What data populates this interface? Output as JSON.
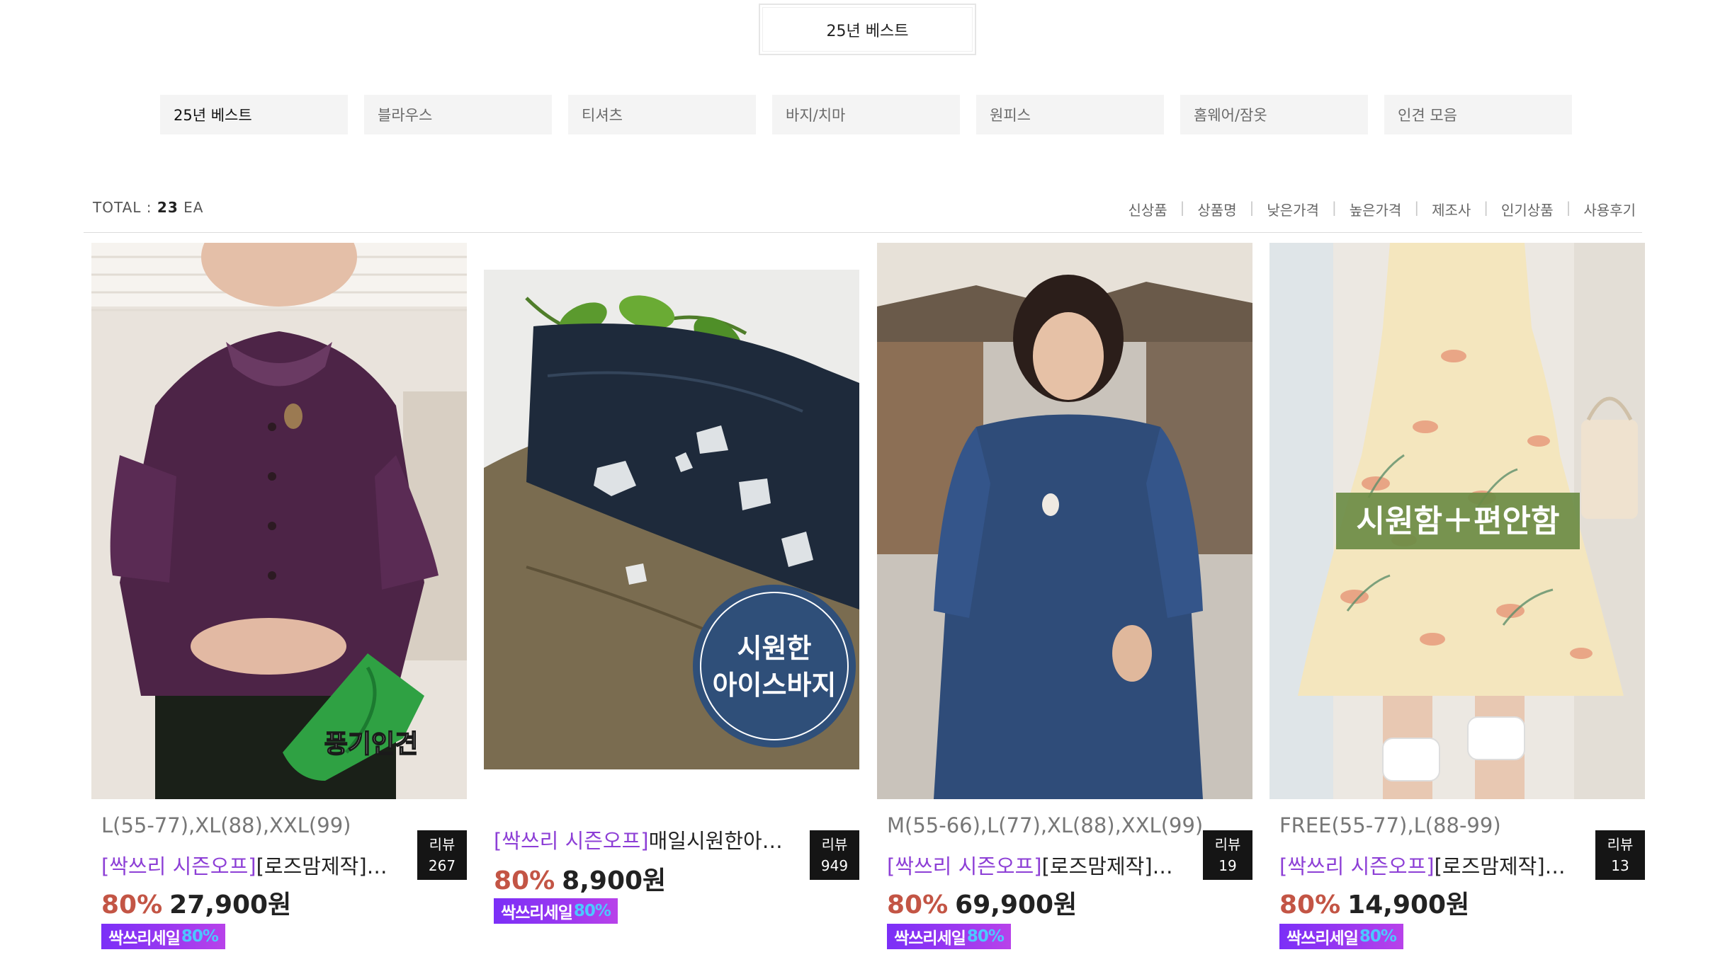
{
  "page_title": "25년 베스트",
  "categories": [
    {
      "label": "25년 베스트",
      "active": true
    },
    {
      "label": "블라우스",
      "active": false
    },
    {
      "label": "티셔츠",
      "active": false
    },
    {
      "label": "바지/치마",
      "active": false
    },
    {
      "label": "원피스",
      "active": false
    },
    {
      "label": "홈웨어/잠옷",
      "active": false
    },
    {
      "label": "인견 모음",
      "active": false
    }
  ],
  "toolbar": {
    "total_label": "TOTAL : ",
    "total_count": "23",
    "total_unit": " EA",
    "sort_options": [
      "신상품",
      "상품명",
      "낮은가격",
      "높은가격",
      "제조사",
      "인기상품",
      "사용후기"
    ],
    "separator": "|"
  },
  "products": [
    {
      "sizes": "L(55-77),XL(88),XXL(99)",
      "tag": "[싹쓰리 시즌오프]",
      "name": "[로즈맘제작]진화…",
      "discount": "80%",
      "price": "27,900원",
      "badge_text": "싹쓰리세일",
      "badge_pct": "80%",
      "review_label": "리뷰",
      "review_count": "267",
      "image_text": "풍기인견",
      "image_icon": "leaf-icon"
    },
    {
      "sizes": "",
      "tag": "[싹쓰리 시즌오프]",
      "name": "매일시원한아이…",
      "discount": "80%",
      "price": "8,900원",
      "badge_text": "싹쓰리세일",
      "badge_pct": "80%",
      "review_label": "리뷰",
      "review_count": "949",
      "image_text_line1": "시원한",
      "image_text_line2": "아이스바지"
    },
    {
      "sizes": "M(55-66),L(77),XL(88),XXL(99)",
      "tag": "[싹쓰리 시즌오프]",
      "name": "[로즈맘제작]연우…",
      "discount": "80%",
      "price": "69,900원",
      "badge_text": "싹쓰리세일",
      "badge_pct": "80%",
      "review_label": "리뷰",
      "review_count": "19"
    },
    {
      "sizes": "FREE(55-77),L(88-99)",
      "tag": "[싹쓰리 시즌오프]",
      "name": "[로즈맘제작]다름…",
      "discount": "80%",
      "price": "14,900원",
      "badge_text": "싹쓰리세일",
      "badge_pct": "80%",
      "review_label": "리뷰",
      "review_count": "13",
      "image_text": "시원함＋편안함"
    }
  ],
  "colors": {
    "tag_purple": "#8d3fd6",
    "discount_red": "#c35545",
    "badge_gradient_start": "#7b2ff7",
    "badge_pct": "#4cc8ff",
    "review_box_bg": "#151515",
    "tab_bg": "#f4f4f4"
  }
}
